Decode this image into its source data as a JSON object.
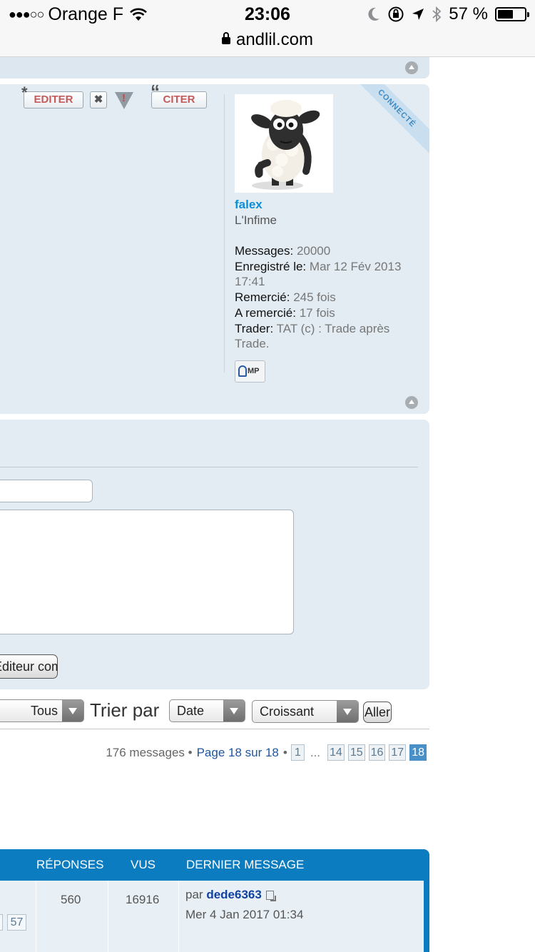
{
  "status_bar": {
    "signal": "●●●○○",
    "carrier": "Orange F",
    "time": "23:06",
    "battery": "57 %",
    "battery_level": 0.57
  },
  "browser": {
    "domain": "andlil.com"
  },
  "post": {
    "edit_label": "EDITER",
    "delete_label": "✖",
    "quote_label": "CITER",
    "online_badge": "CONNECTÉ",
    "username": "falex",
    "rank": "L'Infime",
    "stats": [
      {
        "label": "Messages:",
        "value": "20000"
      },
      {
        "label": "Enregistré le:",
        "value": "Mar 12 Fév 2013 17:41"
      },
      {
        "label": "Remercié:",
        "value": "245 fois"
      },
      {
        "label": "A remercié:",
        "value": "17 fois"
      },
      {
        "label": "Trader:",
        "value": "TAT (c) : Trade après Trade."
      }
    ],
    "pm_label": "MP"
  },
  "quick_reply": {
    "full_editor_label": "Éditeur complet"
  },
  "sort": {
    "period_value": "Tous",
    "sort_by_label": "Trier par",
    "sort_field_value": "Date",
    "sort_order_value": "Croissant",
    "go_label": "Aller"
  },
  "pagination": {
    "count": "176 messages •",
    "page_of": "Page 18 sur 18",
    "bullet": "•",
    "pages": [
      "1",
      "14",
      "15",
      "16",
      "17",
      "18"
    ],
    "ellipsis": "...",
    "current": "18"
  },
  "table": {
    "headers": {
      "replies": "RÉPONSES",
      "views": "VUS",
      "last_post": "DERNIER MESSAGE"
    },
    "row": {
      "pages_visible": [
        "57"
      ],
      "replies": "560",
      "views": "16916",
      "by_prefix": "par",
      "author": "dede6363",
      "date": "Mer 4 Jan 2017 01:34"
    }
  }
}
